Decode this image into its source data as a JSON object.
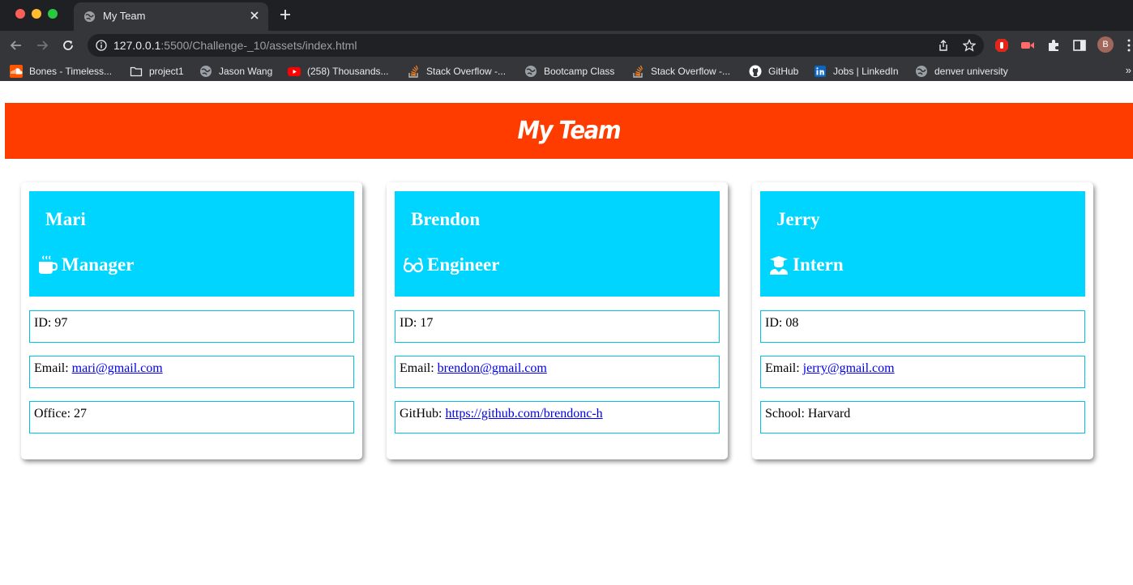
{
  "browser": {
    "tab_title": "My Team",
    "url_host": "127.0.0.1",
    "url_rest": ":5500/Challenge-_10/assets/index.html",
    "profile_initial": "B",
    "bookmarks": [
      {
        "label": "Bones - Timeless...",
        "icon": "soundcloud-icon"
      },
      {
        "label": "project1",
        "icon": "folder-icon"
      },
      {
        "label": "Jason Wang",
        "icon": "globe-icon"
      },
      {
        "label": "(258) Thousands...",
        "icon": "youtube-icon"
      },
      {
        "label": "Stack Overflow -...",
        "icon": "stackoverflow-icon"
      },
      {
        "label": "Bootcamp Class",
        "icon": "globe-icon"
      },
      {
        "label": "Stack Overflow -...",
        "icon": "stackoverflow-icon"
      },
      {
        "label": "GitHub",
        "icon": "github-icon"
      },
      {
        "label": "Jobs | LinkedIn",
        "icon": "linkedin-icon"
      },
      {
        "label": "denver university",
        "icon": "globe-icon"
      }
    ],
    "bookmarks_overflow": "»"
  },
  "page": {
    "title": "My Team",
    "colors": {
      "banner": "#ff3c00",
      "card_header": "#00d5ff",
      "field_border": "#00c3e8",
      "link": "#0000ee"
    },
    "cards": [
      {
        "name": "Mari",
        "role": "Manager",
        "role_icon": "coffee-mug-icon",
        "id_label": "ID: 97",
        "email_prefix": "Email: ",
        "email": "mari@gmail.com",
        "extra_prefix": "Office: 27",
        "extra_link": ""
      },
      {
        "name": "Brendon",
        "role": "Engineer",
        "role_icon": "glasses-icon",
        "id_label": "ID: 17",
        "email_prefix": "Email: ",
        "email": "brendon@gmail.com",
        "extra_prefix": "GitHub: ",
        "extra_link": "https://github.com/brendonc-h"
      },
      {
        "name": "Jerry",
        "role": "Intern",
        "role_icon": "graduate-icon",
        "id_label": "ID: 08",
        "email_prefix": "Email: ",
        "email": "jerry@gmail.com",
        "extra_prefix": "School: Harvard",
        "extra_link": ""
      }
    ]
  }
}
